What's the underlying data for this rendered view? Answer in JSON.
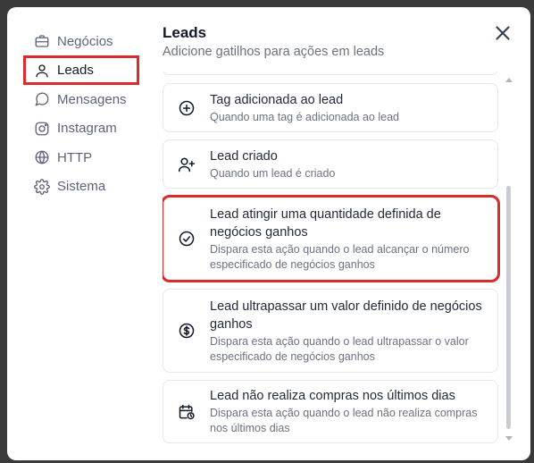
{
  "sidebar": {
    "items": [
      {
        "label": "Negócios",
        "icon": "briefcase-icon"
      },
      {
        "label": "Leads",
        "icon": "user-icon",
        "active": true
      },
      {
        "label": "Mensagens",
        "icon": "message-circle-icon"
      },
      {
        "label": "Instagram",
        "icon": "instagram-icon"
      },
      {
        "label": "HTTP",
        "icon": "globe-icon"
      },
      {
        "label": "Sistema",
        "icon": "gear-icon"
      }
    ]
  },
  "header": {
    "title": "Leads",
    "subtitle": "Adicione gatilhos para ações em leads"
  },
  "triggers": [
    {
      "title": "Tag adicionada ao lead",
      "description": "Quando uma tag é adicionada ao lead",
      "icon": "plus-circle-icon"
    },
    {
      "title": "Lead criado",
      "description": "Quando um lead é criado",
      "icon": "user-plus-icon"
    },
    {
      "title": "Lead atingir uma quantidade definida de negócios ganhos",
      "description": "Dispara esta ação quando o lead alcançar o número especificado de negócios ganhos",
      "icon": "check-circle-icon",
      "highlighted": true
    },
    {
      "title": "Lead ultrapassar um valor definido de negócios ganhos",
      "description": "Dispara esta ação quando o lead ultrapassar o valor especificado de negócios ganhos",
      "icon": "dollar-circle-icon"
    },
    {
      "title": "Lead não realiza compras nos últimos dias",
      "description": "Dispara esta ação quando o lead não realiza compras nos últimos dias",
      "icon": "calendar-clock-icon"
    }
  ],
  "colors": {
    "highlight": "#d92d2d",
    "text": "#111827",
    "muted": "#6b7280",
    "border": "#e5e7eb"
  }
}
